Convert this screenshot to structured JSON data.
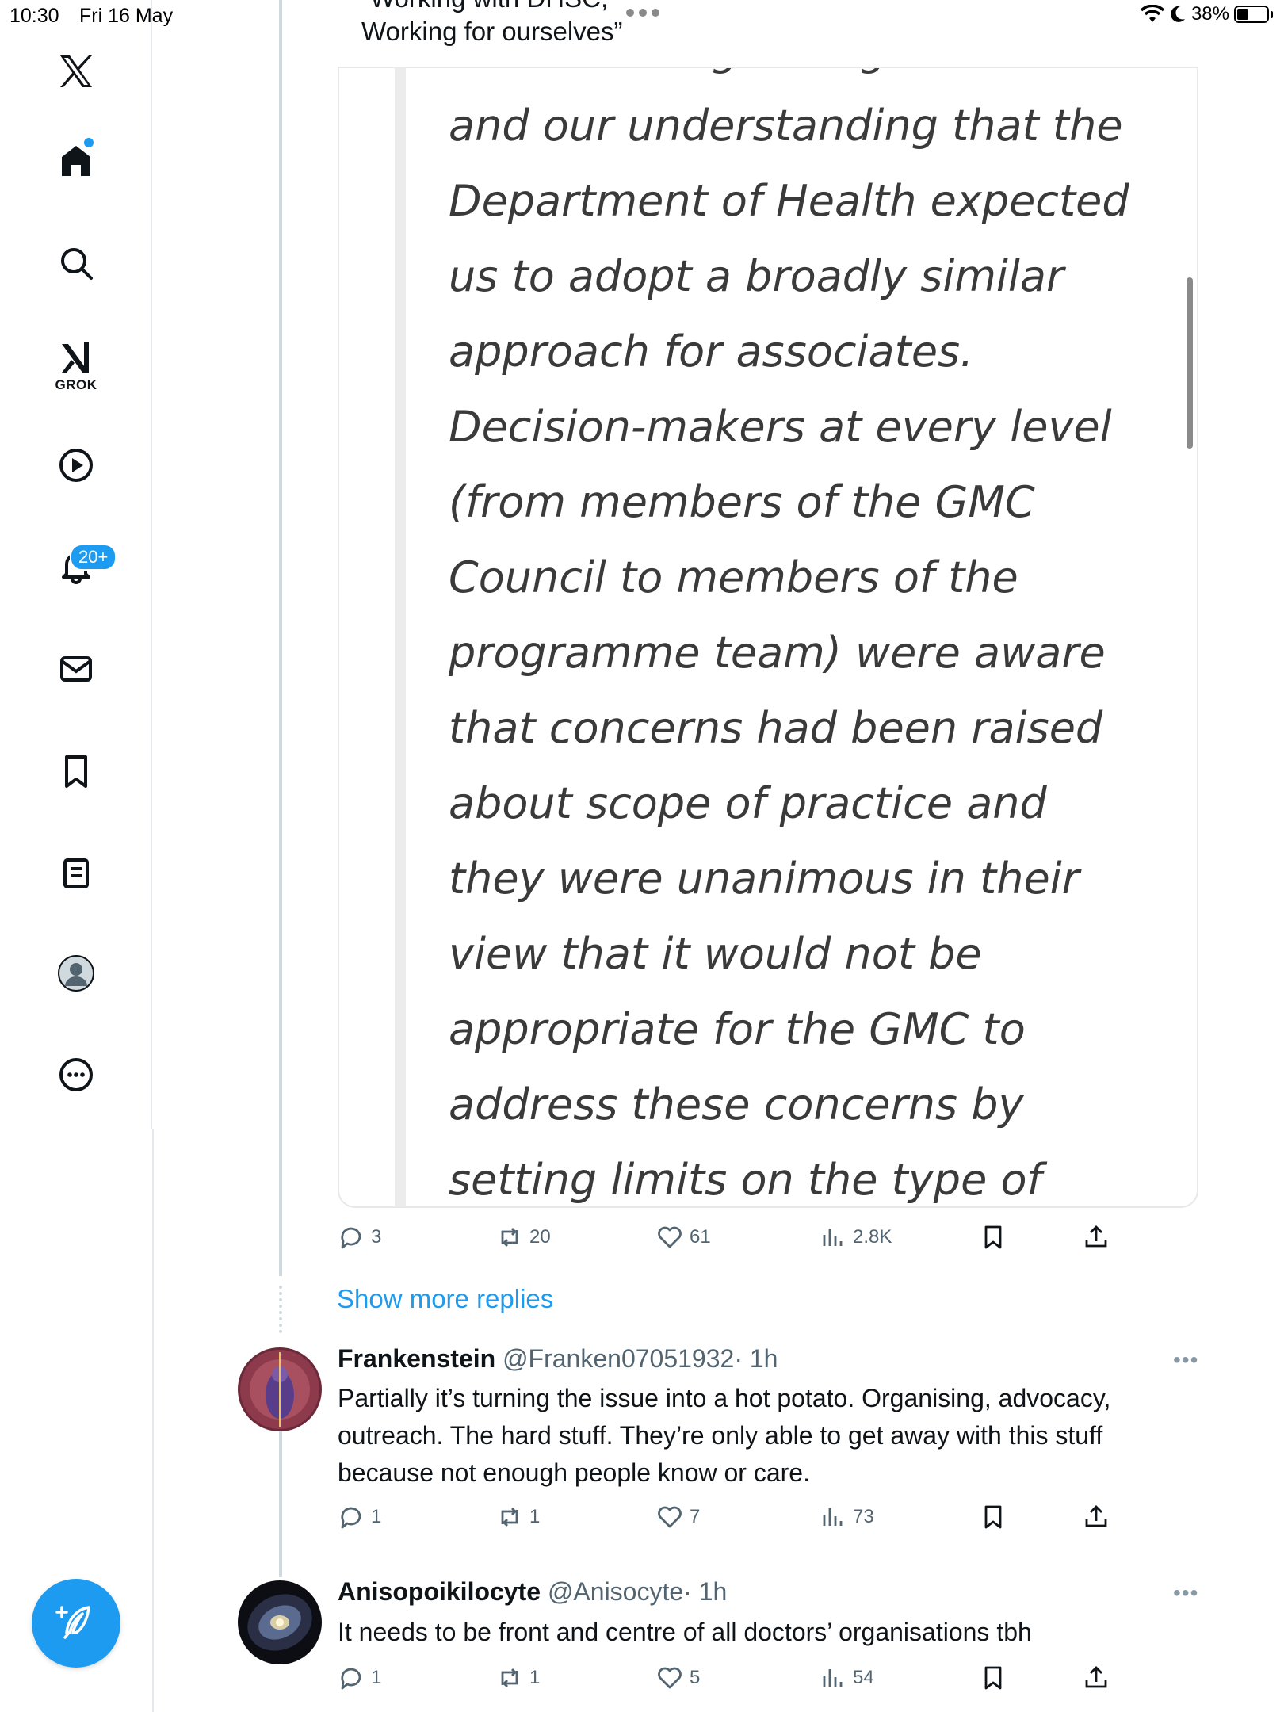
{
  "status_bar": {
    "time": "10:30",
    "date": "Fri 16 May",
    "battery": "38%"
  },
  "nav": {
    "grok_label": "GROK",
    "notifications_badge": "20+"
  },
  "quote": {
    "cut_line": "“Working with DHSC,",
    "line2": "Working for ourselves”"
  },
  "media": {
    "lines": [
      "model for regulating doctors",
      "and our understanding that the",
      "Department of Health expected",
      "us to adopt a broadly similar",
      "approach for associates.",
      "Decision-makers at every level",
      "(from members of the GMC",
      "Council to members of the",
      "programme team) were aware",
      "that concerns had been raised",
      "about scope of practice and",
      "they were unanimous in their",
      "view that it would not be",
      "appropriate for the GMC to",
      "address these concerns by",
      "setting limits on the type of"
    ]
  },
  "main_actions": {
    "replies": "3",
    "retweets": "20",
    "likes": "61",
    "views": "2.8K"
  },
  "show_more_replies": "Show more replies",
  "replies": [
    {
      "name": "Frankenstein",
      "handle": "@Franken07051932",
      "time": "· 1h",
      "text": "Partially it’s turning the issue into a hot potato. Organising, advocacy, outreach. The hard stuff. They’re only able to get away with this stuff because not enough people know or care.",
      "replies": "1",
      "retweets": "1",
      "likes": "7",
      "views": "73"
    },
    {
      "name": "Anisopoikilocyte",
      "handle": "@Anisocyte",
      "time": "· 1h",
      "text": "It needs to be front and centre of all doctors’ organisations tbh",
      "replies": "1",
      "retweets": "1",
      "likes": "5",
      "views": "54"
    }
  ],
  "colors": {
    "accent": "#1d9bf0",
    "text": "#0f1419",
    "muted": "#536471",
    "border": "#e6e9ec"
  }
}
